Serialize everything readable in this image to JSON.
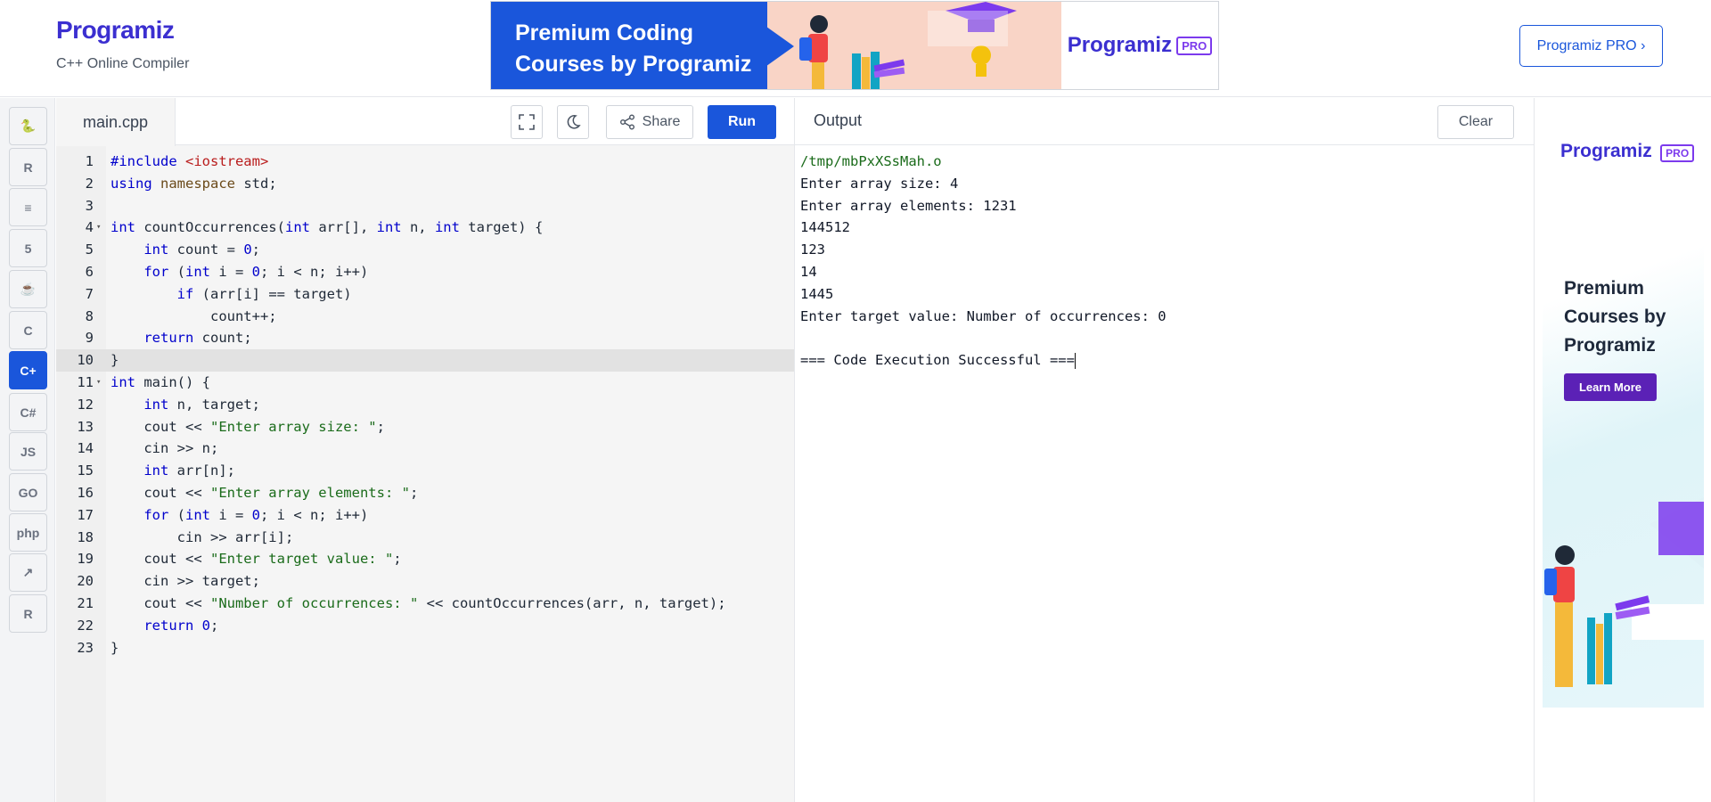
{
  "header": {
    "logo_text": "Programiz",
    "subtitle": "C++ Online Compiler",
    "ad": {
      "headline_1": "Premium Coding",
      "headline_2": "Courses by Programiz",
      "brand": "Programiz",
      "badge": "PRO"
    },
    "pro_button": "Programiz PRO ›"
  },
  "lang_rail": [
    {
      "name": "python-icon",
      "glyph": "🐍",
      "active": false
    },
    {
      "name": "r-icon",
      "glyph": "R",
      "active": false
    },
    {
      "name": "sql-database-icon",
      "glyph": "≡",
      "active": false
    },
    {
      "name": "html5-icon",
      "glyph": "5",
      "active": false
    },
    {
      "name": "java-icon",
      "glyph": "☕",
      "active": false
    },
    {
      "name": "c-icon",
      "glyph": "C",
      "active": false
    },
    {
      "name": "cpp-icon",
      "glyph": "C+",
      "active": true
    },
    {
      "name": "csharp-icon",
      "glyph": "C#",
      "active": false
    },
    {
      "name": "javascript-icon",
      "glyph": "JS",
      "active": false
    },
    {
      "name": "go-icon",
      "glyph": "GO",
      "active": false
    },
    {
      "name": "php-icon",
      "glyph": "php",
      "active": false
    },
    {
      "name": "swift-icon",
      "glyph": "↗",
      "active": false
    },
    {
      "name": "rust-icon",
      "glyph": "R",
      "active": false
    }
  ],
  "editor": {
    "file_name": "main.cpp",
    "share_label": "Share",
    "run_label": "Run",
    "current_line": 10,
    "folded_lines": [
      4,
      11
    ],
    "lines": [
      "#include <iostream>",
      "using namespace std;",
      "",
      "int countOccurrences(int arr[], int n, int target) {",
      "    int count = 0;",
      "    for (int i = 0; i < n; i++)",
      "        if (arr[i] == target)",
      "            count++;",
      "    return count;",
      "}",
      "int main() {",
      "    int n, target;",
      "    cout << \"Enter array size: \";",
      "    cin >> n;",
      "    int arr[n];",
      "    cout << \"Enter array elements: \";",
      "    for (int i = 0; i < n; i++)",
      "        cin >> arr[i];",
      "    cout << \"Enter target value: \";",
      "    cin >> target;",
      "    cout << \"Number of occurrences: \" << countOccurrences(arr, n, target);",
      "    return 0;",
      "}"
    ]
  },
  "output": {
    "title": "Output",
    "clear_label": "Clear",
    "lines": [
      "/tmp/mbPxXSsMah.o",
      "Enter array size: 4",
      "Enter array elements: 1231",
      "144512",
      "123",
      "14",
      "1445",
      "Enter target value: Number of occurrences: 0",
      "",
      "=== Code Execution Successful ==="
    ]
  },
  "side_ad": {
    "brand": "Programiz",
    "badge": "PRO",
    "text_1": "Premium",
    "text_2": "Courses by",
    "text_3": "Programiz",
    "button": "Learn More"
  },
  "colors": {
    "accent": "#1a56db",
    "brand_purple": "#7c3aed",
    "keyword": "#0000cc",
    "string": "#1a6b1a"
  }
}
